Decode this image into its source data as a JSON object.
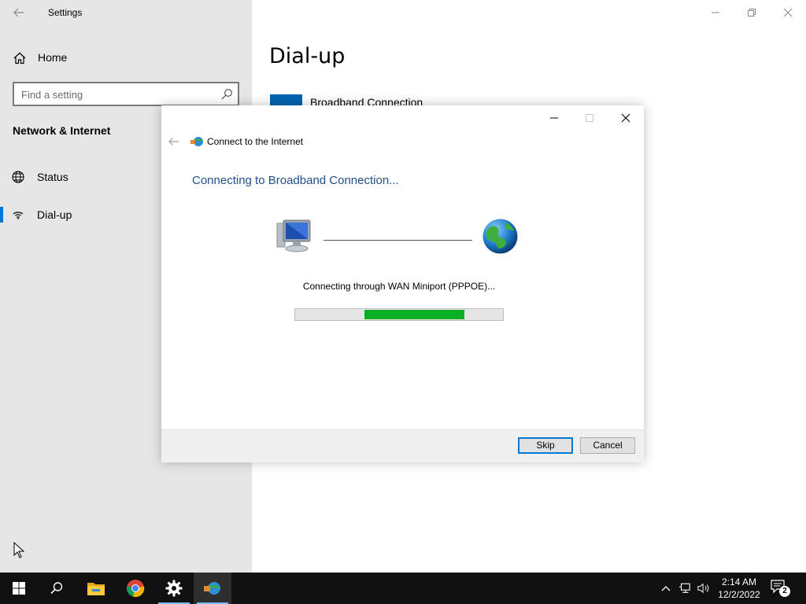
{
  "settings": {
    "app_title": "Settings",
    "home_label": "Home",
    "search_placeholder": "Find a setting",
    "section_title": "Network & Internet",
    "nav": [
      {
        "label": "Status",
        "icon": "globe-icon"
      },
      {
        "label": "Dial-up",
        "icon": "dialup-icon",
        "active": true
      }
    ],
    "page_title": "Dial-up",
    "connection_name": "Broadband Connection"
  },
  "dialog": {
    "title": "Connect to the Internet",
    "heading": "Connecting to Broadband Connection...",
    "status": "Connecting through WAN Miniport (PPPOE)...",
    "progress": 0.48,
    "buttons": {
      "skip": "Skip",
      "cancel": "Cancel"
    }
  },
  "taskbar": {
    "time": "2:14 AM",
    "date": "12/2/2022",
    "notification_count": "2",
    "apps": [
      "start-icon",
      "search-icon",
      "file-explorer-icon",
      "chrome-icon",
      "settings-icon",
      "connect-internet-icon"
    ]
  },
  "colors": {
    "accent": "#0078d7",
    "progress_fill": "#06b025",
    "heading_blue": "#1f4e8c",
    "sidebar_bg": "#e6e6e6",
    "taskbar_bg": "#101010"
  }
}
